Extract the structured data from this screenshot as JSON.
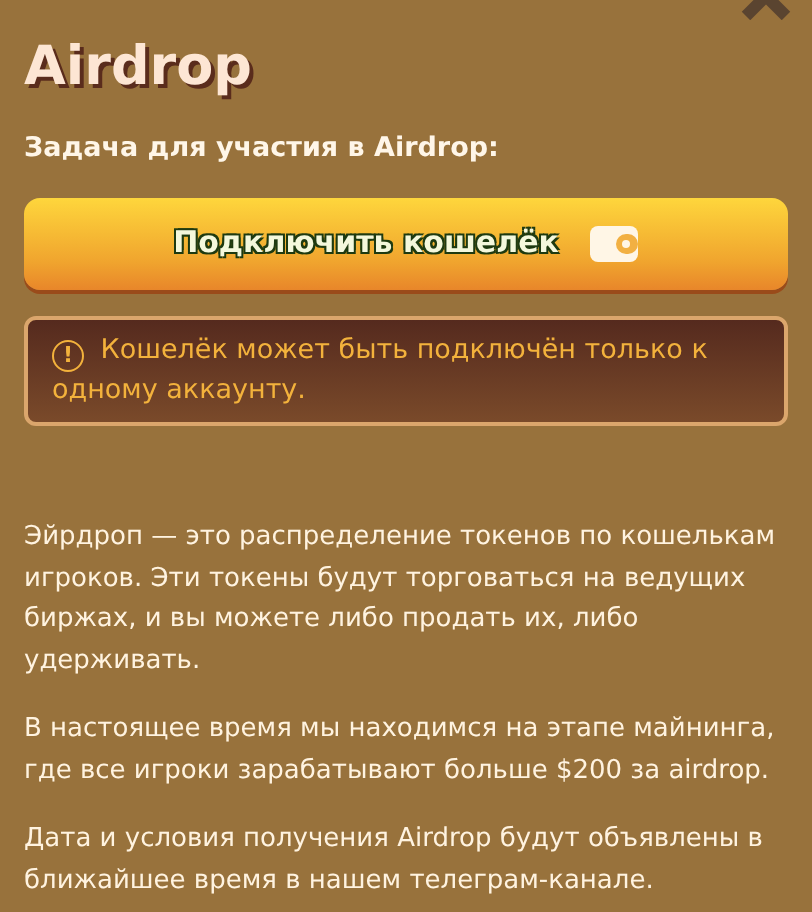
{
  "title": "Airdrop",
  "task_label": "Задача для участия в Airdrop:",
  "connect_button": {
    "label": "Подключить кошелёк"
  },
  "warning": {
    "icon": "!",
    "text": "Кошелёк может быть подключён только к одному аккаунту."
  },
  "paragraphs": [
    "Эйрдроп — это распределение токенов по кошелькам игроков. Эти токены будут торговаться на ведущих биржах, и вы можете либо продать их, либо удерживать.",
    "В настоящее время мы находимся на этапе майнинга, где все игроки зарабатывают больше $200 за airdrop.",
    "Дата и условия получения Airdrop будут объявлены в ближайшее время в нашем телеграм-канале."
  ]
}
